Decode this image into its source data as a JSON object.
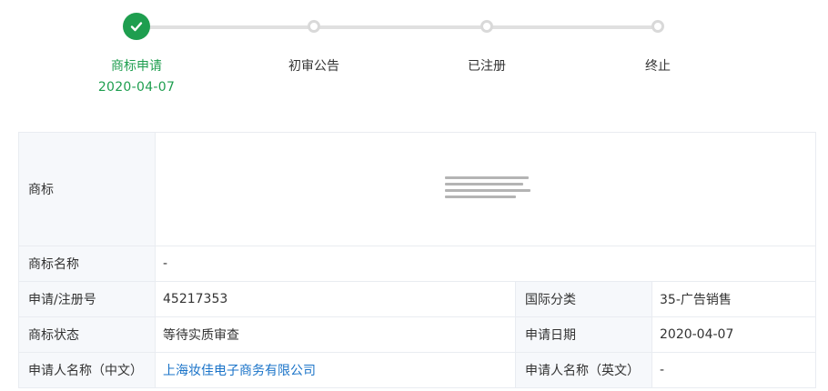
{
  "progress": {
    "fraction_done": 0,
    "steps": [
      {
        "label": "商标申请",
        "date": "2020-04-07",
        "status": "done"
      },
      {
        "label": "初审公告",
        "date": "",
        "status": "pending"
      },
      {
        "label": "已注册",
        "date": "",
        "status": "pending"
      },
      {
        "label": "终止",
        "date": "",
        "status": "pending"
      }
    ]
  },
  "icons": {
    "done": "check-icon"
  },
  "colors": {
    "accent": "#1e9e4f",
    "link": "#1a73c8",
    "label_bg": "#f6f8fb",
    "track": "#e0e0e0"
  },
  "table": {
    "mark_label": "商标",
    "name_label": "商标名称",
    "name_value": "-",
    "regno_label": "申请/注册号",
    "regno_value": "45217353",
    "class_label": "国际分类",
    "class_value": "35-广告销售",
    "status_label": "商标状态",
    "status_value": "等待实质审查",
    "date_label": "申请日期",
    "date_value": "2020-04-07",
    "applicant_cn_label": "申请人名称（中文）",
    "applicant_cn_value": "上海妆佳电子商务有限公司",
    "applicant_en_label": "申请人名称（英文）",
    "applicant_en_value": "-"
  }
}
